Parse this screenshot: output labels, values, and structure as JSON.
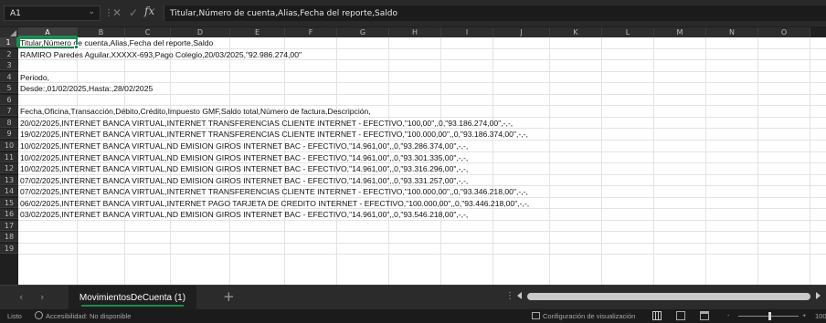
{
  "formula_bar": {
    "name_box": "A1",
    "fx_label": "fx",
    "content": "Titular,Número de cuenta,Alias,Fecha del reporte,Saldo"
  },
  "columns": [
    "A",
    "B",
    "C",
    "D",
    "E",
    "F",
    "G",
    "H",
    "I",
    "J",
    "K",
    "L",
    "M",
    "N",
    "O"
  ],
  "rows": [
    {
      "n": "1",
      "text": "Titular,Número de cuenta,Alias,Fecha del reporte,Saldo"
    },
    {
      "n": "2",
      "text": "RAMIRO Paredes Aguilar,XXXXX-693,Pago Colegio,20/03/2025,\"92.986.274,00\""
    },
    {
      "n": "3",
      "text": ""
    },
    {
      "n": "4",
      "text": "Periodo,"
    },
    {
      "n": "5",
      "text": "Desde:,01/02/2025,Hasta:,28/02/2025"
    },
    {
      "n": "6",
      "text": ""
    },
    {
      "n": "7",
      "text": "Fecha,Oficina,Transacción,Débito,Crédito,Impuesto GMF,Saldo total,Número de factura,Descripción,"
    },
    {
      "n": "8",
      "text": "20/02/2025,INTERNET BANCA VIRTUAL,INTERNET TRANSFERENCIAS CLIENTE INTERNET - EFECTIVO,\"100,00\",,0,\"93.186.274,00\",-,-,"
    },
    {
      "n": "9",
      "text": "19/02/2025,INTERNET BANCA VIRTUAL,INTERNET TRANSFERENCIAS CLIENTE INTERNET - EFECTIVO,\"100.000,00\",,0,\"93.186.374,00\",-,-,"
    },
    {
      "n": "10",
      "text": "10/02/2025,INTERNET BANCA VIRTUAL,ND EMISION GIROS INTERNET BAC - EFECTIVO,\"14.961,00\",,0,\"93.286.374,00\",-,-,"
    },
    {
      "n": "11",
      "text": "10/02/2025,INTERNET BANCA VIRTUAL,ND EMISION GIROS INTERNET BAC - EFECTIVO,\"14.961,00\",,0,\"93.301.335,00\",-,-,"
    },
    {
      "n": "12",
      "text": "10/02/2025,INTERNET BANCA VIRTUAL,ND EMISION GIROS INTERNET BAC - EFECTIVO,\"14.961,00\",,0,\"93.316.296,00\",-,-,"
    },
    {
      "n": "13",
      "text": "07/02/2025,INTERNET BANCA VIRTUAL,ND EMISION GIROS INTERNET BAC - EFECTIVO,\"14.961,00\",,0,\"93.331.257,00\",-,-,"
    },
    {
      "n": "14",
      "text": "07/02/2025,INTERNET BANCA VIRTUAL,INTERNET TRANSFERENCIAS CLIENTE INTERNET - EFECTIVO,\"100.000,00\",,0,\"93.346.218,00\",-,-,"
    },
    {
      "n": "15",
      "text": "06/02/2025,INTERNET BANCA VIRTUAL,INTERNET PAGO TARJETA DE CREDITO INTERNET - EFECTIVO,\"100.000,00\",,0,\"93.446.218,00\",-,-,"
    },
    {
      "n": "16",
      "text": "03/02/2025,INTERNET BANCA VIRTUAL,ND EMISION GIROS INTERNET BAC - EFECTIVO,\"14.961,00\",,0,\"93.546.218,00\",-,-,"
    },
    {
      "n": "17",
      "text": ""
    },
    {
      "n": "18",
      "text": ""
    },
    {
      "n": "19",
      "text": ""
    }
  ],
  "tabs": {
    "sheet_name": "MovimientosDeCuenta (1)",
    "add_label": "+"
  },
  "status": {
    "ready": "Listo",
    "accessibility": "Accesibilidad: No disponible",
    "display_settings": "Configuración de visualización",
    "zoom_minus": "-",
    "zoom_plus": "+",
    "zoom": "100"
  },
  "colors": {
    "accent": "#1e8a52",
    "chrome": "#2b2b2b",
    "sheet": "#ffffff"
  }
}
